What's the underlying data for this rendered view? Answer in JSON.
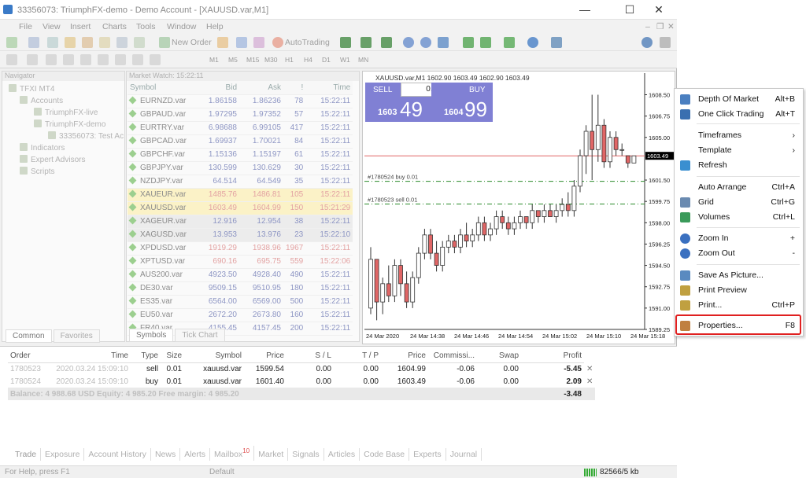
{
  "window": {
    "title": "33356073: TriumphFX-demo - Demo Account - [XAUUSD.var,M1]",
    "minimize": "—",
    "maximize": "☐",
    "close": "✕"
  },
  "menu": [
    "File",
    "View",
    "Insert",
    "Charts",
    "Tools",
    "Window",
    "Help"
  ],
  "toolbar": {
    "new_order": "New Order",
    "autotrading": "AutoTrading",
    "timeframes": [
      "M1",
      "M5",
      "M15",
      "M30",
      "H1",
      "H4",
      "D1",
      "W1",
      "MN"
    ]
  },
  "navigator": {
    "title": "Navigator",
    "items": [
      "TFXI MT4",
      "Accounts",
      "TriumphFX-live",
      "TriumphFX-demo",
      "33356073: Test Ac",
      "Indicators",
      "Expert Advisors",
      "Scripts"
    ],
    "tabs": [
      "Common",
      "Favorites"
    ]
  },
  "market_watch": {
    "title": "Market Watch: 15:22:11",
    "headers": [
      "Symbol",
      "Bid",
      "Ask",
      "!",
      "Time"
    ],
    "rows": [
      {
        "symbol": "EURNZD.var",
        "bid": "1.86158",
        "ask": "1.86236",
        "spread": "78",
        "time": "15:22:11",
        "style": ""
      },
      {
        "symbol": "GBPAUD.var",
        "bid": "1.97295",
        "ask": "1.97352",
        "spread": "57",
        "time": "15:22:11",
        "style": ""
      },
      {
        "symbol": "EURTRY.var",
        "bid": "6.98688",
        "ask": "6.99105",
        "spread": "417",
        "time": "15:22:11",
        "style": ""
      },
      {
        "symbol": "GBPCAD.var",
        "bid": "1.69937",
        "ask": "1.70021",
        "spread": "84",
        "time": "15:22:11",
        "style": ""
      },
      {
        "symbol": "GBPCHF.var",
        "bid": "1.15136",
        "ask": "1.15197",
        "spread": "61",
        "time": "15:22:11",
        "style": ""
      },
      {
        "symbol": "GBPJPY.var",
        "bid": "130.599",
        "ask": "130.629",
        "spread": "30",
        "time": "15:22:11",
        "style": ""
      },
      {
        "symbol": "NZDJPY.var",
        "bid": "64.514",
        "ask": "64.549",
        "spread": "35",
        "time": "15:22:11",
        "style": ""
      },
      {
        "symbol": "XAUEUR.var",
        "bid": "1485.76",
        "ask": "1486.81",
        "spread": "105",
        "time": "15:22:11",
        "style": "hl"
      },
      {
        "symbol": "XAUUSD.var",
        "bid": "1603.49",
        "ask": "1604.99",
        "spread": "150",
        "time": "15:21:29",
        "style": "hl"
      },
      {
        "symbol": "XAGEUR.var",
        "bid": "12.916",
        "ask": "12.954",
        "spread": "38",
        "time": "15:22:11",
        "style": "grey"
      },
      {
        "symbol": "XAGUSD.var",
        "bid": "13.953",
        "ask": "13.976",
        "spread": "23",
        "time": "15:22:10",
        "style": "grey"
      },
      {
        "symbol": "XPDUSD.var",
        "bid": "1919.29",
        "ask": "1938.96",
        "spread": "1967",
        "time": "15:22:11",
        "style": "red"
      },
      {
        "symbol": "XPTUSD.var",
        "bid": "690.16",
        "ask": "695.75",
        "spread": "559",
        "time": "15:22:06",
        "style": "red"
      },
      {
        "symbol": "AUS200.var",
        "bid": "4923.50",
        "ask": "4928.40",
        "spread": "490",
        "time": "15:22:11",
        "style": ""
      },
      {
        "symbol": "DE30.var",
        "bid": "9509.15",
        "ask": "9510.95",
        "spread": "180",
        "time": "15:22:11",
        "style": ""
      },
      {
        "symbol": "ES35.var",
        "bid": "6564.00",
        "ask": "6569.00",
        "spread": "500",
        "time": "15:22:11",
        "style": ""
      },
      {
        "symbol": "EU50.var",
        "bid": "2672.20",
        "ask": "2673.80",
        "spread": "160",
        "time": "15:22:11",
        "style": ""
      },
      {
        "symbol": "FR40.var",
        "bid": "4155.45",
        "ask": "4157.45",
        "spread": "200",
        "time": "15:22:11",
        "style": ""
      }
    ],
    "tabs": [
      "Symbols",
      "Tick Chart"
    ]
  },
  "chart": {
    "header": "XAUUSD.var,M1  1602.90 1603.49 1602.90 1603.49",
    "sell_label": "SELL",
    "buy_label": "BUY",
    "lot": "0.01",
    "sell_small": "1603",
    "sell_big": "49",
    "buy_small": "1604",
    "buy_big": "99",
    "order_lines": [
      "#1780524 buy 0.01",
      "#1780523 sell 0.01"
    ],
    "current_price": "1603.49",
    "price_ticks": [
      "1608.50",
      "1606.75",
      "1605.00",
      "1601.50",
      "1599.75",
      "1598.00",
      "1596.25",
      "1594.50",
      "1592.75",
      "1591.00",
      "1589.25"
    ],
    "time_ticks": [
      "24 Mar 2020",
      "24 Mar 14:38",
      "24 Mar 14:46",
      "24 Mar 14:54",
      "24 Mar 15:02",
      "24 Mar 15:10",
      "24 Mar 15:18"
    ],
    "colors": {
      "bull": "#ffffff",
      "bear": "#e06666",
      "outline": "#333333",
      "grid": "#dddddd",
      "order": "#2a8a2a",
      "price": "#e06666"
    }
  },
  "chart_data": {
    "type": "candlestick",
    "ylim": [
      1589.25,
      1609.5
    ],
    "candles": [
      [
        1591.0,
        1596.0,
        1590.5,
        1595.0
      ],
      [
        1595.0,
        1594.5,
        1590.0,
        1591.5
      ],
      [
        1591.5,
        1593.5,
        1590.5,
        1593.0
      ],
      [
        1593.0,
        1594.5,
        1591.5,
        1592.0
      ],
      [
        1592.0,
        1595.0,
        1591.5,
        1594.5
      ],
      [
        1594.5,
        1595.0,
        1592.0,
        1593.0
      ],
      [
        1593.0,
        1594.0,
        1591.0,
        1591.5
      ],
      [
        1591.5,
        1594.0,
        1591.0,
        1593.5
      ],
      [
        1593.5,
        1596.0,
        1593.0,
        1595.5
      ],
      [
        1595.5,
        1597.5,
        1595.0,
        1597.0
      ],
      [
        1597.0,
        1597.5,
        1595.0,
        1595.5
      ],
      [
        1595.5,
        1596.5,
        1594.0,
        1594.5
      ],
      [
        1594.5,
        1596.5,
        1594.0,
        1596.0
      ],
      [
        1596.0,
        1597.0,
        1595.5,
        1596.5
      ],
      [
        1596.5,
        1597.0,
        1595.5,
        1596.0
      ],
      [
        1596.0,
        1597.5,
        1595.5,
        1597.0
      ],
      [
        1597.0,
        1598.0,
        1596.0,
        1596.5
      ],
      [
        1596.5,
        1597.5,
        1596.0,
        1597.0
      ],
      [
        1597.0,
        1598.5,
        1596.5,
        1598.0
      ],
      [
        1598.0,
        1598.5,
        1596.5,
        1597.0
      ],
      [
        1597.0,
        1598.0,
        1596.5,
        1597.5
      ],
      [
        1597.5,
        1599.0,
        1597.0,
        1598.5
      ],
      [
        1598.5,
        1599.0,
        1597.5,
        1598.0
      ],
      [
        1598.0,
        1598.5,
        1597.0,
        1597.5
      ],
      [
        1597.5,
        1598.5,
        1597.0,
        1598.0
      ],
      [
        1598.0,
        1599.0,
        1597.5,
        1598.5
      ],
      [
        1598.5,
        1598.5,
        1597.5,
        1598.0
      ],
      [
        1598.0,
        1599.5,
        1597.5,
        1599.0
      ],
      [
        1599.0,
        1599.0,
        1598.0,
        1598.5
      ],
      [
        1598.5,
        1599.5,
        1598.0,
        1599.0
      ],
      [
        1599.0,
        1599.5,
        1598.5,
        1598.5
      ],
      [
        1598.5,
        1599.5,
        1598.0,
        1599.0
      ],
      [
        1599.0,
        1600.0,
        1598.5,
        1599.5
      ],
      [
        1599.5,
        1600.5,
        1598.5,
        1599.0
      ],
      [
        1599.0,
        1601.5,
        1598.5,
        1601.0
      ],
      [
        1601.0,
        1604.0,
        1600.5,
        1603.5
      ],
      [
        1603.5,
        1606.0,
        1602.0,
        1605.5
      ],
      [
        1605.5,
        1608.5,
        1601.5,
        1604.0
      ],
      [
        1604.0,
        1608.5,
        1603.0,
        1606.0
      ],
      [
        1606.0,
        1606.5,
        1602.5,
        1603.0
      ],
      [
        1603.0,
        1605.5,
        1602.5,
        1605.0
      ],
      [
        1605.0,
        1605.5,
        1603.5,
        1604.0
      ],
      [
        1604.0,
        1604.5,
        1603.5,
        1604.0
      ],
      [
        1603.5,
        1603.5,
        1602.5,
        1602.9
      ],
      [
        1602.9,
        1603.49,
        1602.9,
        1603.49
      ]
    ]
  },
  "context_menu": [
    {
      "label": "Depth Of Market",
      "shortcut": "Alt+B",
      "icon": "depth-of-market-icon"
    },
    {
      "label": "One Click Trading",
      "shortcut": "Alt+T",
      "icon": "one-click-trading-icon"
    },
    {
      "label": "Timeframes",
      "shortcut": "›",
      "icon": ""
    },
    {
      "label": "Template",
      "shortcut": "›",
      "icon": ""
    },
    {
      "label": "Refresh",
      "shortcut": "",
      "icon": "refresh-icon"
    },
    {
      "label": "Auto Arrange",
      "shortcut": "Ctrl+A",
      "icon": ""
    },
    {
      "label": "Grid",
      "shortcut": "Ctrl+G",
      "icon": "grid-icon"
    },
    {
      "label": "Volumes",
      "shortcut": "Ctrl+L",
      "icon": "volumes-icon"
    },
    {
      "label": "Zoom In",
      "shortcut": "+",
      "icon": "zoom-in-icon"
    },
    {
      "label": "Zoom Out",
      "shortcut": "-",
      "icon": "zoom-out-icon"
    },
    {
      "label": "Save As Picture...",
      "shortcut": "",
      "icon": "save-picture-icon"
    },
    {
      "label": "Print Preview",
      "shortcut": "",
      "icon": "print-preview-icon"
    },
    {
      "label": "Print...",
      "shortcut": "Ctrl+P",
      "icon": "print-icon"
    },
    {
      "label": "Properties...",
      "shortcut": "F8",
      "icon": "properties-icon"
    }
  ],
  "terminal": {
    "headers": [
      "Order",
      "Time",
      "Type",
      "Size",
      "Symbol",
      "Price",
      "S / L",
      "T / P",
      "Price",
      "Commissi...",
      "Swap",
      "Profit"
    ],
    "rows": [
      [
        "1780523",
        "2020.03.24 15:09:10",
        "sell",
        "0.01",
        "xauusd.var",
        "1599.54",
        "0.00",
        "0.00",
        "1604.99",
        "-0.06",
        "0.00",
        "-5.45"
      ],
      [
        "1780524",
        "2020.03.24 15:09:10",
        "buy",
        "0.01",
        "xauusd.var",
        "1601.40",
        "0.00",
        "0.00",
        "1603.49",
        "-0.06",
        "0.00",
        "2.09"
      ]
    ],
    "balance": "Balance: 4 988.68 USD  Equity: 4 985.20  Free margin: 4 985.20",
    "total": "-3.48",
    "tabs": [
      "Trade",
      "Exposure",
      "Account History",
      "News",
      "Alerts",
      "Mailbox",
      "Market",
      "Signals",
      "Articles",
      "Code Base",
      "Experts",
      "Journal"
    ],
    "mailbox_badge": "10"
  },
  "status": {
    "help": "For Help, press F1",
    "profile": "Default",
    "traffic": "82566/5 kb"
  }
}
